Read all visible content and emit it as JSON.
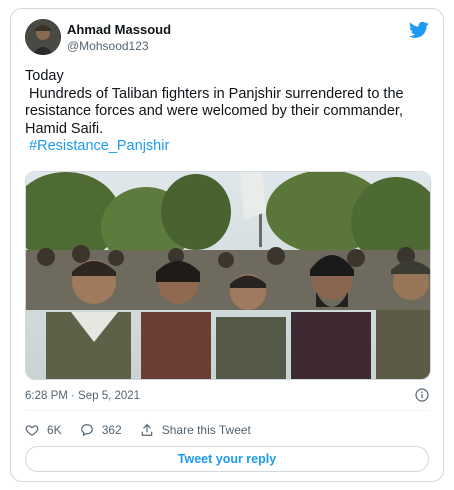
{
  "author": {
    "name": "Ahmad Massoud",
    "handle": "@Mohsood123"
  },
  "tweet": {
    "line1": "Today",
    "line2": " Hundreds of Taliban fighters in Panjshir surrendered to the resistance forces and were welcomed by their commander, Hamid Saifi.",
    "hashtag": " #Resistance_Panjshir"
  },
  "meta": {
    "timestamp": "6:28 PM · Sep 5, 2021"
  },
  "actions": {
    "likes": "6K",
    "replies": "362",
    "share_label": "Share this Tweet"
  },
  "reply_button": "Tweet your reply",
  "colors": {
    "accent": "#1d9bf0",
    "text": "#0f1419",
    "muted": "#536471",
    "border": "#cfd9de"
  }
}
